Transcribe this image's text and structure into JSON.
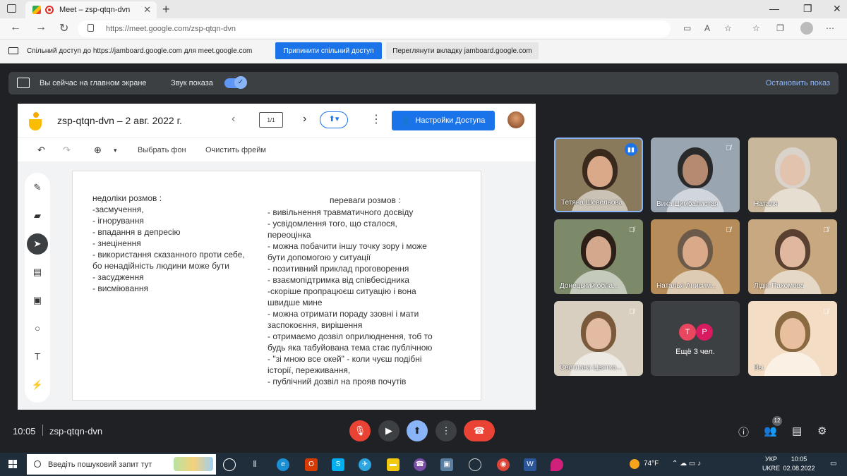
{
  "browser": {
    "tab_title": "Meet – zsp-qtqn-dvn",
    "tab_close": "✕",
    "new_tab": "+",
    "url": "https://meet.google.com/zsp-qtqn-dvn",
    "window_controls": [
      "—",
      "❐",
      "✕"
    ]
  },
  "share_notice": {
    "text": "Спільний доступ до https://jamboard.google.com для meet.google.com",
    "stop_button": "Припинити спільний доступ",
    "view_button": "Переглянути вкладку jamboard.google.com"
  },
  "presenting_bar": {
    "label": "Вы сейчас на главном экране",
    "sound_label": "Звук показа",
    "stop_label": "Остановить показ"
  },
  "jamboard": {
    "title": "zsp-qtqn-dvn – 2 авг. 2022 г.",
    "frame_counter": "1/1",
    "share_button": "Настройки Доступа",
    "tool_bg": "Выбрать фон",
    "tool_clear": "Очистить фрейм",
    "note_left": "недоліки розмов :\n-засмучення,\n- ігнорування\n- впадання в депресію\n- знецінення\n- використання сказанного проти себе,\nбо ненадійність людини може бути\n- засудження\n- висміювання",
    "note_right_title": "переваги розмов :",
    "note_right": "- вивільнення травматичного досвіду\n- усвідомлення того, що сталося,\nпереоцінка\n- можна побачити іншу точку зору і може\nбути допомогою у ситуації\n- позитивний приклад проговорення\n- взаємопідтримка від співбесідника\n-скоріше пропрацюєш ситуацію і вона\nшвидше мине\n- можна отримати пораду ззовні і мати\nзаспокоєння, вирішення\n- отримаємо дозвіл оприлюднення, тоб то\nбудь яка табуйована тема стає публічною\n- \"зі мною все окей\" - коли чуєш подібні\nісторії, переживання,\n- публічний дозвіл на прояв почутів"
  },
  "participants": [
    {
      "name": "Тетяна Шевельова",
      "bg": "#8a7a5c",
      "skin": "#d9a98a",
      "hair": "#3a2a1e"
    },
    {
      "name": "Вика Цимбалистая",
      "bg": "#9aa5b2",
      "skin": "#b58a70",
      "hair": "#2a2a2a"
    },
    {
      "name": "Наталя",
      "bg": "#c9b79c",
      "skin": "#e2c3ad",
      "hair": "#d9d3cc"
    },
    {
      "name": "Донецький обла...",
      "bg": "#7c8a6a",
      "skin": "#d4a88c",
      "hair": "#2b1f18"
    },
    {
      "name": "Наталья Анисим...",
      "bg": "#b58c5a",
      "skin": "#d9a98a",
      "hair": "#6b5a4a"
    },
    {
      "name": "Лідія Пахомова",
      "bg": "#c8a880",
      "skin": "#e0b8a0",
      "hair": "#5a4030"
    },
    {
      "name": "Светлана Цвятко...",
      "bg": "#d8cfc0",
      "skin": "#e3bba3",
      "hair": "#7a5a3a"
    },
    {
      "name": "Вы",
      "bg": "#f3ddc4",
      "skin": "#e8c0a0",
      "hair": "#8a6a40"
    }
  ],
  "more_tile": {
    "label": "Ещё 3 чел.",
    "bubbles": [
      "T",
      "P"
    ]
  },
  "meet_bar": {
    "time": "10:05",
    "code": "zsp-qtqn-dvn",
    "participants_count": "12"
  },
  "taskbar": {
    "search_placeholder": "Введіть пошуковий запит тут",
    "weather": "74°F",
    "lang_top": "УКР",
    "lang_bottom": "UKRE",
    "time": "10:05",
    "date": "02.08.2022"
  }
}
